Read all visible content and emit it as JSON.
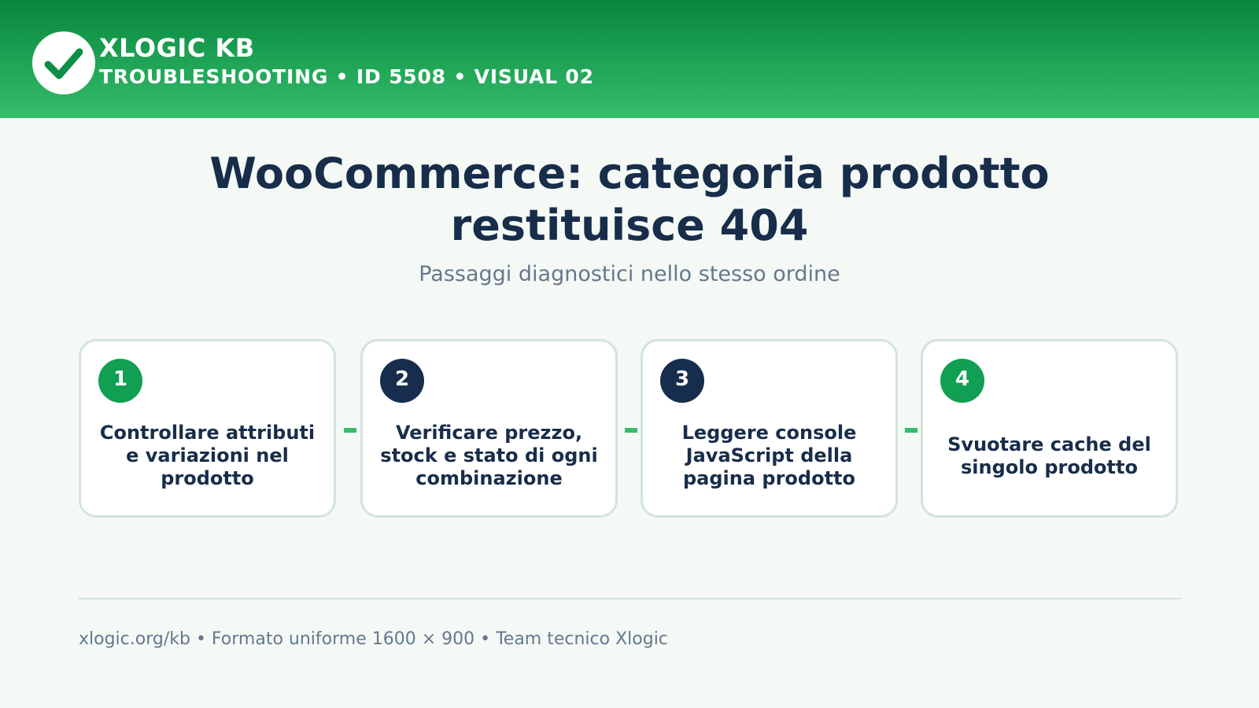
{
  "header": {
    "brand": "XLOGIC KB",
    "subtitle": "TROUBLESHOOTING • ID 5508 • VISUAL 02",
    "logo_icon": "checkmark-icon"
  },
  "title_lines": [
    "WooCommerce: categoria prodotto",
    "restituisce 404"
  ],
  "subtitle": "Passaggi diagnostici nello stesso ordine",
  "steps": [
    {
      "number": "1",
      "text": "Controllare attributi e variazioni nel prodotto",
      "color": "#109f53"
    },
    {
      "number": "2",
      "text": "Verificare prezzo, stock e stato di ogni combinazione",
      "color": "#172d4d"
    },
    {
      "number": "3",
      "text": "Leggere console JavaScript della pagina prodotto",
      "color": "#172d4d"
    },
    {
      "number": "4",
      "text": "Svuotare cache del singolo prodotto",
      "color": "#109f53"
    }
  ],
  "footer": "xlogic.org/kb • Formato uniforme 1600 × 900 • Team tecnico Xlogic",
  "colors": {
    "header_top": "#07863e",
    "header_bottom": "#35bd6a",
    "accent": "#35bd6a",
    "navy": "#182d4a",
    "muted": "#66788c",
    "background": "#f4f9f6"
  }
}
